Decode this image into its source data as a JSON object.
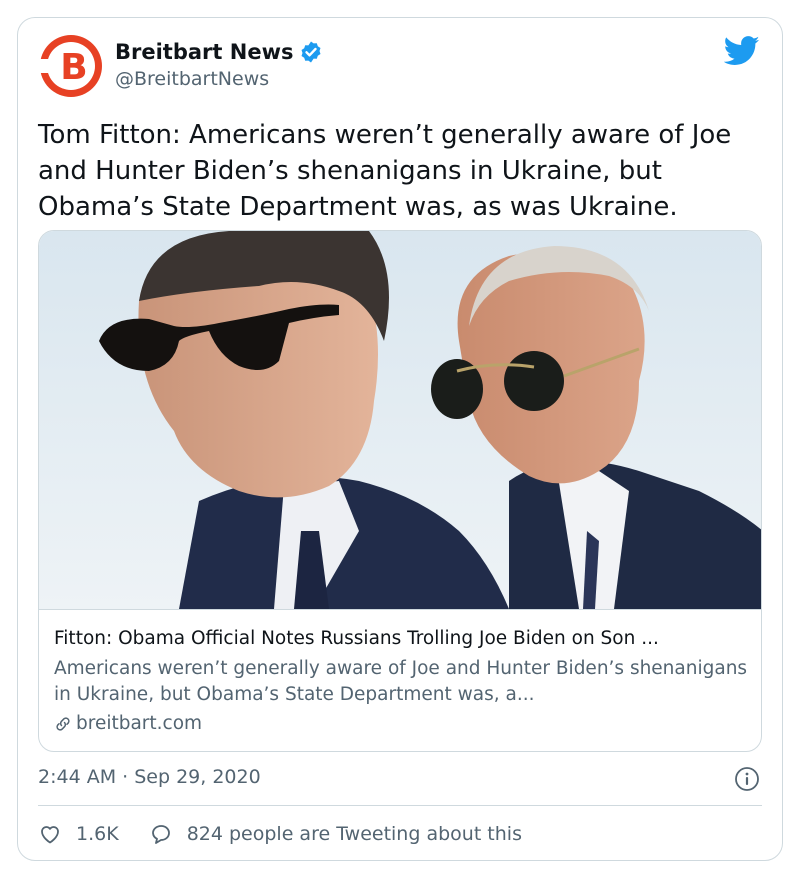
{
  "author": {
    "display_name": "Breitbart News",
    "handle": "@BreitbartNews",
    "avatar_letter": "B",
    "verified": true
  },
  "tweet": {
    "text": "Tom Fitton: Americans weren’t generally aware of Joe and Hunter Biden’s shenanigans in Ukraine, but Obama’s State Department was, as was Ukraine.",
    "timestamp": "2:44 AM · Sep 29, 2020"
  },
  "card": {
    "title": "Fitton: Obama Official Notes Russians Trolling Joe Biden on Son ...",
    "description": "Americans weren’t generally aware of Joe and Hunter Biden’s shenanigans in Ukraine, but Obama’s State Department was, a...",
    "domain": "breitbart.com"
  },
  "actions": {
    "likes": "1.6K",
    "conversation": "824 people are Tweeting about this"
  },
  "colors": {
    "brand_red": "#e74124",
    "twitter_blue": "#1d9bf0",
    "secondary_text": "#536471",
    "border": "#cfd9de"
  },
  "icons": [
    "twitter-logo-icon",
    "verified-badge-icon",
    "link-icon",
    "info-icon",
    "heart-icon",
    "reply-bubble-icon"
  ]
}
